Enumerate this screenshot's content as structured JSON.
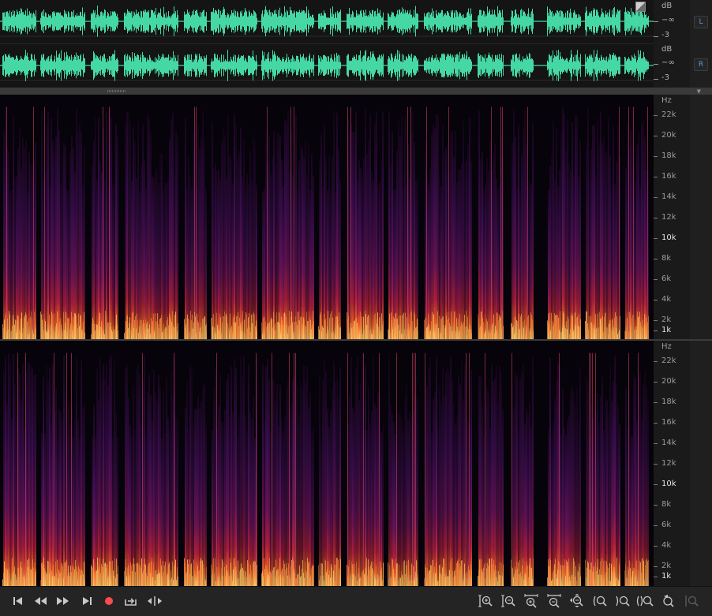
{
  "waveform": {
    "channels": [
      {
        "label": "L",
        "db_unit": "dB",
        "db_marks": [
          "−∞",
          "-3"
        ]
      },
      {
        "label": "R",
        "db_unit": "dB",
        "db_marks": [
          "−∞",
          "-3"
        ]
      }
    ],
    "color": "#45d8a4"
  },
  "spectrogram": {
    "unit": "Hz",
    "freq_labels": [
      "22k",
      "20k",
      "18k",
      "16k",
      "14k",
      "12k",
      "10k",
      "8k",
      "6k",
      "4k",
      "2k",
      "1k"
    ],
    "bright_labels": [
      "10k",
      "1k"
    ]
  },
  "toolbar": {
    "transport": [
      {
        "name": "go-to-start-icon"
      },
      {
        "name": "rewind-icon"
      },
      {
        "name": "fast-forward-icon"
      },
      {
        "name": "go-to-end-icon"
      },
      {
        "name": "record-icon",
        "color": "#ff4b4b"
      },
      {
        "name": "loop-output-icon"
      },
      {
        "name": "skip-selection-icon"
      }
    ],
    "zoom": [
      {
        "name": "zoom-in-amplitude-icon"
      },
      {
        "name": "zoom-out-amplitude-icon"
      },
      {
        "name": "zoom-in-time-icon"
      },
      {
        "name": "zoom-out-time-icon"
      },
      {
        "name": "zoom-out-full-icon"
      },
      {
        "name": "zoom-in-left-icon"
      },
      {
        "name": "zoom-in-right-icon"
      },
      {
        "name": "zoom-selection-icon"
      },
      {
        "name": "zoom-reset-icon"
      },
      {
        "name": "zoom-disabled-icon"
      }
    ]
  }
}
